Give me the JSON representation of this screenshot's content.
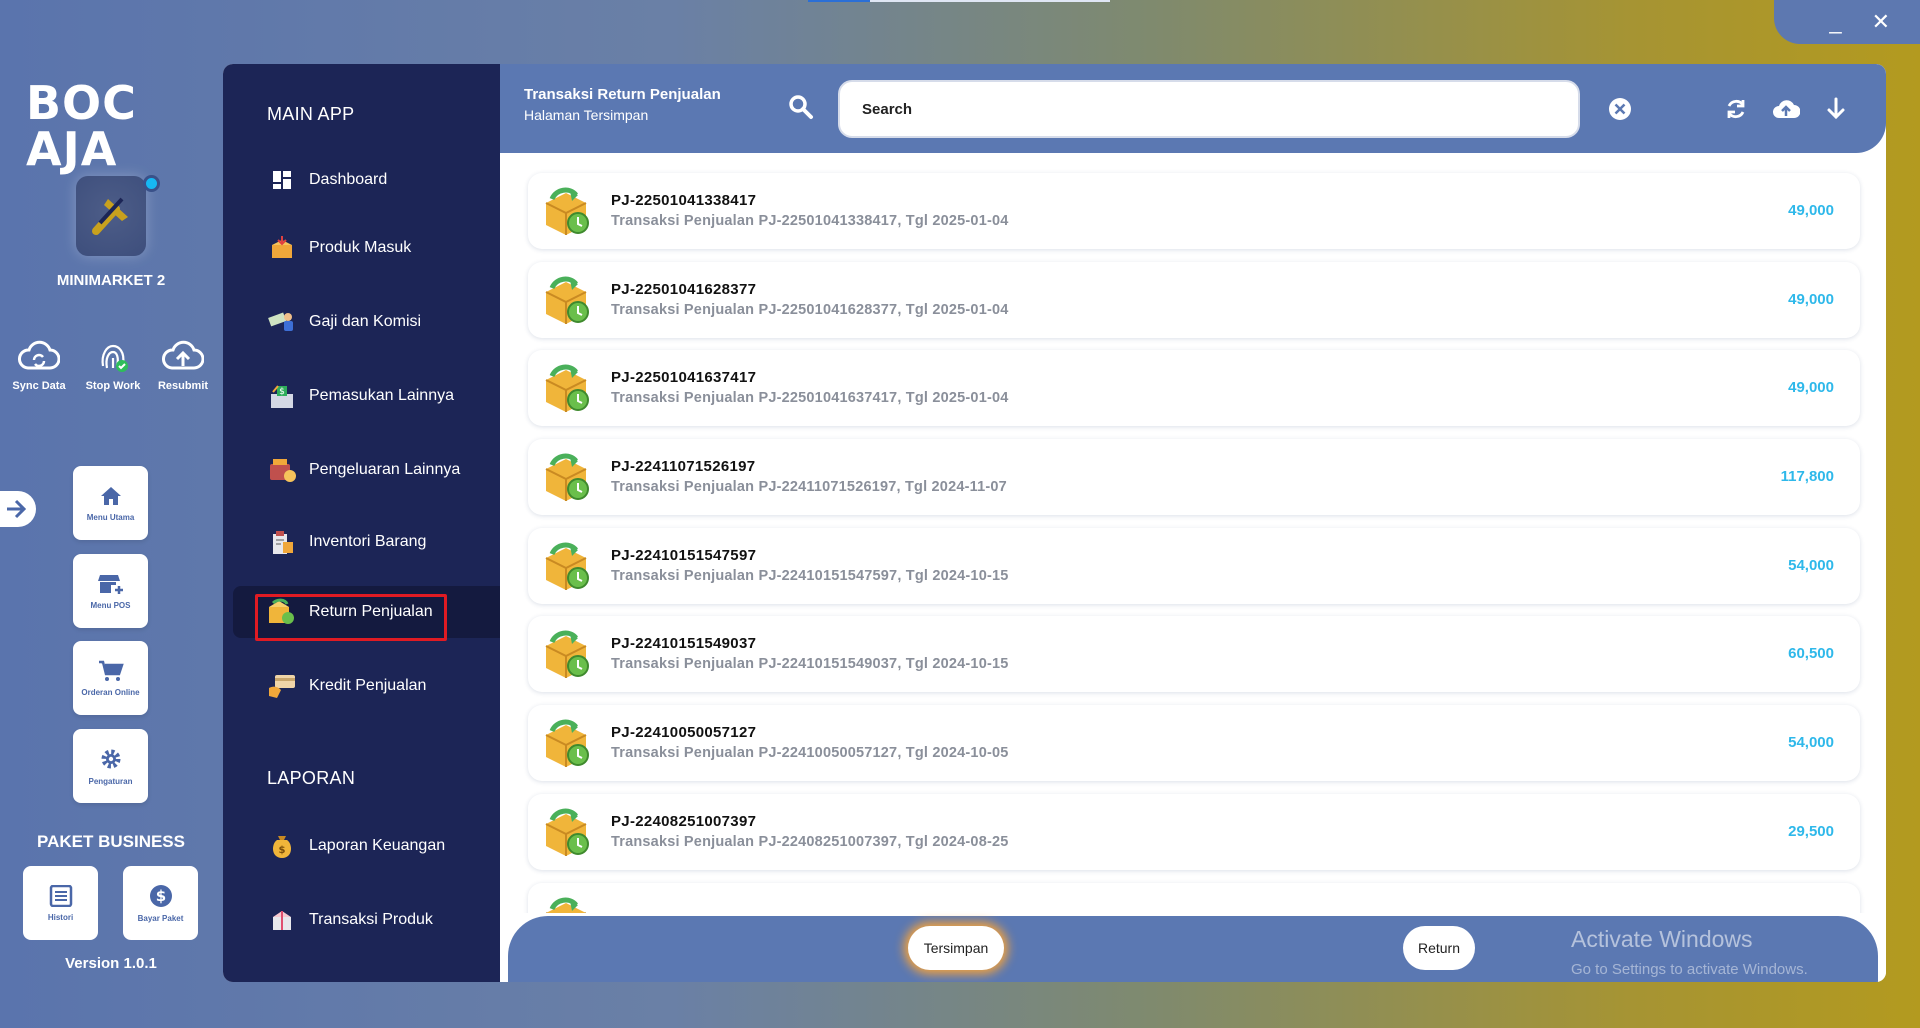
{
  "window": {
    "minimize_label": "_",
    "close_label": "✕"
  },
  "brand": {
    "logo_text": "BOC AJA",
    "store_name": "MINIMARKET 2"
  },
  "quick_actions": [
    {
      "label": "Sync Data",
      "icon": "sync-cloud-icon"
    },
    {
      "label": "Stop Work",
      "icon": "fingerprint-icon"
    },
    {
      "label": "Resubmit",
      "icon": "cloud-upload-icon"
    }
  ],
  "rail_menu": [
    {
      "label": "Menu Utama",
      "icon": "home-icon"
    },
    {
      "label": "Menu POS",
      "icon": "store-icon"
    },
    {
      "label": "Orderan Online",
      "icon": "cart-icon"
    },
    {
      "label": "Pengaturan",
      "icon": "gear-icon"
    }
  ],
  "package": {
    "title": "PAKET BUSINESS",
    "items": [
      {
        "label": "Histori",
        "icon": "list-icon"
      },
      {
        "label": "Bayar Paket",
        "icon": "dollar-icon"
      }
    ],
    "version": "Version 1.0.1"
  },
  "nav": {
    "section_main": "MAIN APP",
    "section_report": "LAPORAN",
    "items": [
      {
        "label": "Dashboard",
        "icon": "dashboard-icon"
      },
      {
        "label": "Produk Masuk",
        "icon": "box-in-icon"
      },
      {
        "label": "Gaji dan Komisi",
        "icon": "salary-icon"
      },
      {
        "label": "Pemasukan Lainnya",
        "icon": "income-icon"
      },
      {
        "label": "Pengeluaran Lainnya",
        "icon": "expense-icon"
      },
      {
        "label": "Inventori Barang",
        "icon": "inventory-icon"
      },
      {
        "label": "Return Penjualan",
        "icon": "return-icon",
        "active": true
      },
      {
        "label": "Kredit Penjualan",
        "icon": "credit-icon"
      }
    ],
    "report_items": [
      {
        "label": "Laporan Keuangan",
        "icon": "money-bag-icon"
      },
      {
        "label": "Transaksi Produk",
        "icon": "product-icon"
      }
    ]
  },
  "header": {
    "title": "Transaksi Return Penjualan",
    "subtitle": "Halaman Tersimpan",
    "search_placeholder": "Search"
  },
  "transactions": [
    {
      "code": "PJ-22501041338417",
      "desc": "Transaksi Penjualan PJ-22501041338417, Tgl 2025-01-04",
      "amount": "49,000"
    },
    {
      "code": "PJ-22501041628377",
      "desc": "Transaksi Penjualan PJ-22501041628377, Tgl 2025-01-04",
      "amount": "49,000"
    },
    {
      "code": "PJ-22501041637417",
      "desc": "Transaksi Penjualan PJ-22501041637417, Tgl 2025-01-04",
      "amount": "49,000"
    },
    {
      "code": "PJ-22411071526197",
      "desc": "Transaksi Penjualan PJ-22411071526197, Tgl 2024-11-07",
      "amount": "117,800"
    },
    {
      "code": "PJ-22410151547597",
      "desc": "Transaksi Penjualan PJ-22410151547597, Tgl 2024-10-15",
      "amount": "54,000"
    },
    {
      "code": "PJ-22410151549037",
      "desc": "Transaksi Penjualan PJ-22410151549037, Tgl 2024-10-15",
      "amount": "60,500"
    },
    {
      "code": "PJ-22410050057127",
      "desc": "Transaksi Penjualan PJ-22410050057127, Tgl 2024-10-05",
      "amount": "54,000"
    },
    {
      "code": "PJ-22408251007397",
      "desc": "Transaksi Penjualan PJ-22408251007397, Tgl 2024-08-25",
      "amount": "29,500"
    }
  ],
  "footer": {
    "tab_saved": "Tersimpan",
    "tab_return": "Return",
    "watermark_title": "Activate Windows",
    "watermark_sub": "Go to Settings to activate Windows."
  }
}
